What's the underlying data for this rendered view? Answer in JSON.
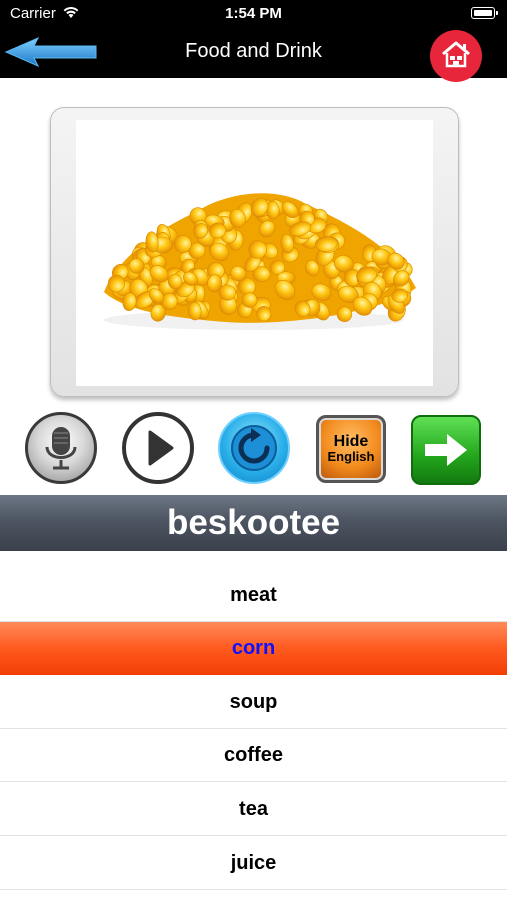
{
  "status_bar": {
    "carrier": "Carrier",
    "time": "1:54 PM"
  },
  "nav": {
    "title": "Food and Drink",
    "back_icon": "back-arrow-icon",
    "home_icon": "home-icon"
  },
  "card": {
    "image": "corn kernels"
  },
  "controls": {
    "mic_icon": "microphone-icon",
    "play_icon": "play-icon",
    "replay_icon": "replay-icon",
    "hide_line1": "Hide",
    "hide_line2": "English",
    "next_icon": "next-arrow-icon"
  },
  "word": "beskootee",
  "list": {
    "items": [
      "meat",
      "corn",
      "soup",
      "coffee",
      "tea",
      "juice"
    ],
    "selected": "corn"
  },
  "colors": {
    "home_button": "#e8263b",
    "selected_row": "#ff5a1e",
    "selected_text": "#1010ff"
  }
}
